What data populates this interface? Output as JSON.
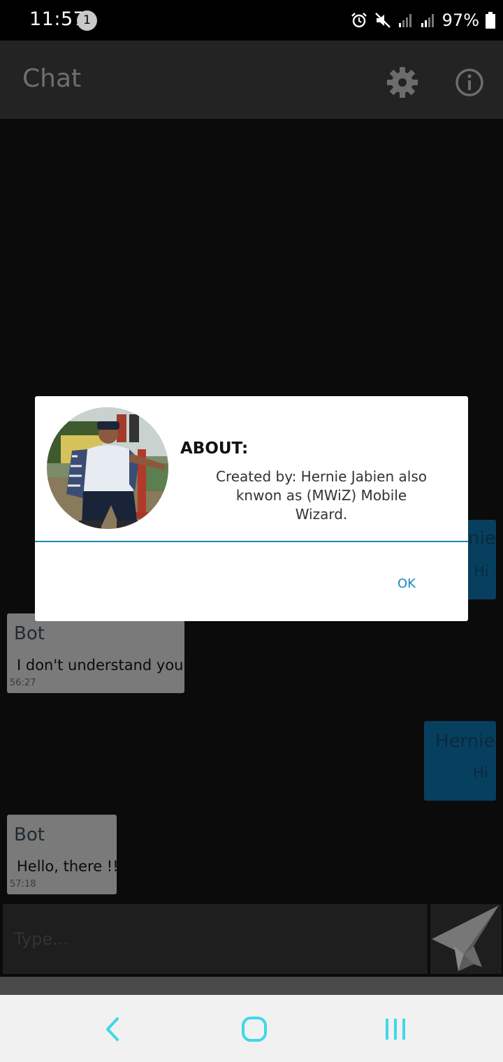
{
  "status_bar": {
    "time": "11:57",
    "notification_count": "1",
    "battery": "97%"
  },
  "app_bar": {
    "title": "Chat",
    "settings_icon": "gear-icon",
    "info_icon": "info-icon"
  },
  "messages": [
    {
      "sender": "Bot",
      "text": "I don't understand you !",
      "time": "56:27",
      "side": "left"
    },
    {
      "sender": "Hernie",
      "text": "Hi",
      "time": "",
      "side": "right"
    },
    {
      "sender": "Bot",
      "text": "Hello, there !!",
      "time": "57:18",
      "side": "left"
    }
  ],
  "peek_bubble": {
    "sender_fragment": "nie",
    "text": "Hi"
  },
  "input": {
    "placeholder": "Type...",
    "send_icon": "paper-plane-icon"
  },
  "dialog": {
    "title": "ABOUT:",
    "body": "Created by: Hernie Jabien also knwon as (MWiZ) Mobile Wizard.",
    "ok_label": "OK",
    "avatar": "profile-photo"
  },
  "nav_bar": {
    "back_icon": "back-icon",
    "home_icon": "home-icon",
    "recents_icon": "recents-icon",
    "accent": "#3fd8e8"
  }
}
